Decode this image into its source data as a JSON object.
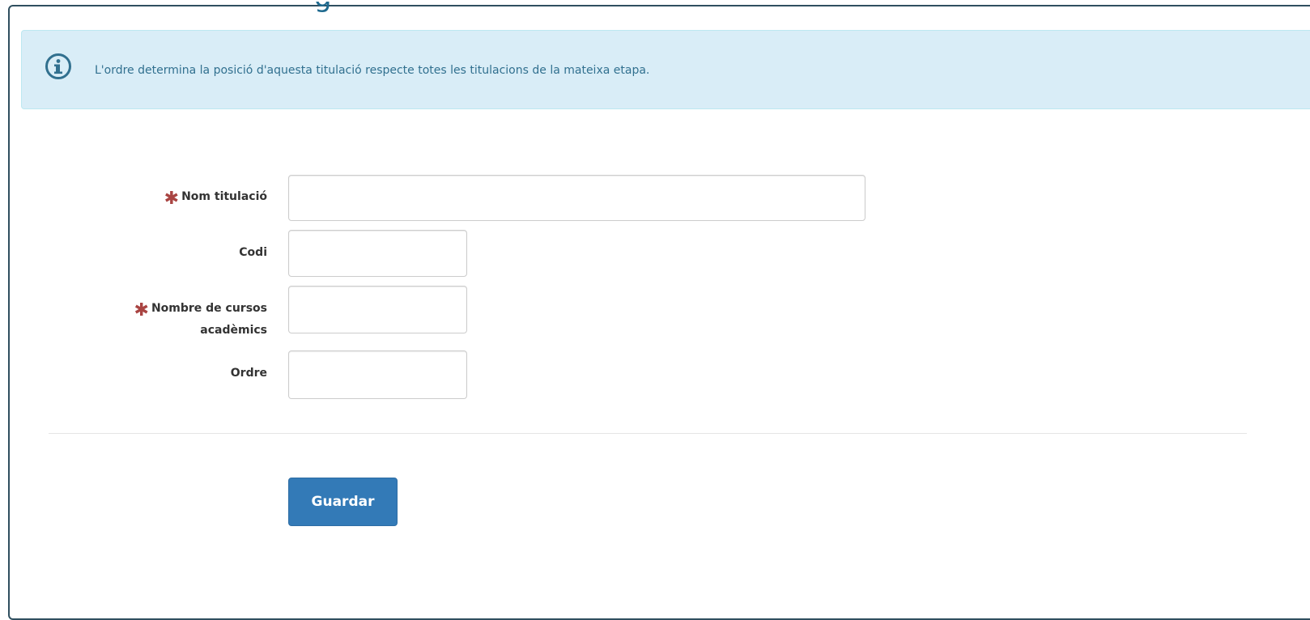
{
  "info": {
    "icon": "info-circle-icon",
    "message": "L'ordre determina la posició d'aquesta titulació respecte totes les titulacions de la mateixa etapa."
  },
  "form": {
    "fields": [
      {
        "label": "Nom titulació",
        "required": true,
        "value": ""
      },
      {
        "label": "Codi",
        "required": false,
        "value": ""
      },
      {
        "label_line1": "Nombre de cursos",
        "label_line2": "acadèmics",
        "required": true,
        "value": ""
      },
      {
        "label": "Ordre",
        "required": false,
        "value": ""
      }
    ],
    "required_marker": "✱",
    "save_label": "Guardar"
  },
  "colors": {
    "info_bg": "#d9edf7",
    "info_text": "#31708f",
    "required": "#a94442",
    "primary": "#337ab7"
  }
}
